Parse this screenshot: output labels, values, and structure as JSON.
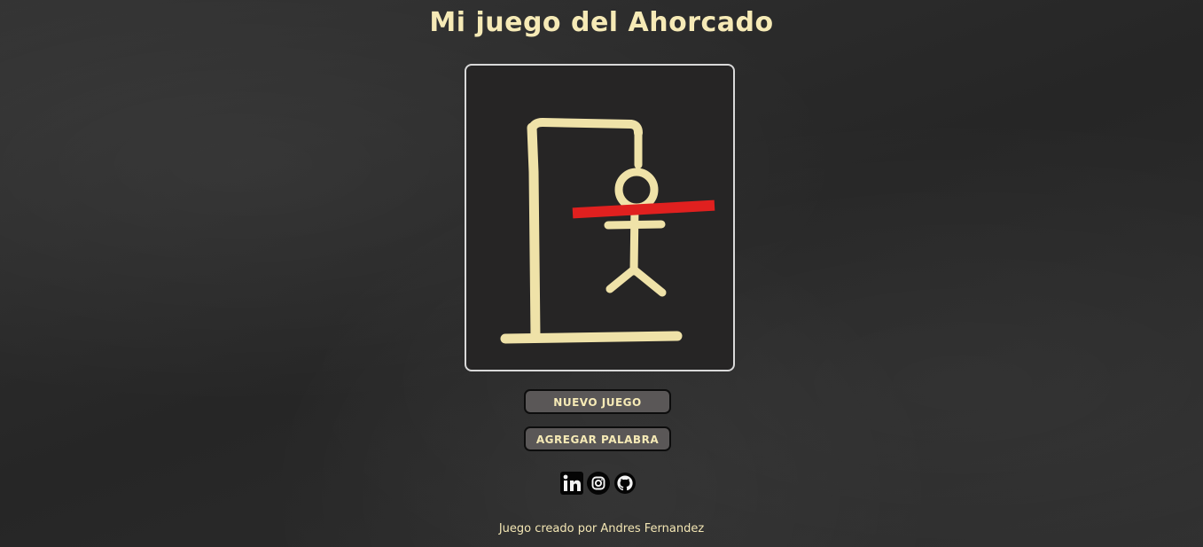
{
  "page": {
    "title": "Mi juego del Ahorcado"
  },
  "game": {
    "state": "lost",
    "crossed_out": true
  },
  "buttons": {
    "new_game_label": "NUEVO JUEGO",
    "add_word_label": "AGREGAR PALABRA"
  },
  "socials": [
    {
      "name": "linkedin-icon"
    },
    {
      "name": "instagram-icon"
    },
    {
      "name": "github-icon"
    }
  ],
  "footer": {
    "credit": "Juego creado por Andres Fernandez"
  },
  "colors": {
    "background": "#2b2b2b",
    "chalk": "#efe2a8",
    "strike": "#e0201f",
    "button_bg": "#5a5757",
    "title": "#f6eab6"
  }
}
